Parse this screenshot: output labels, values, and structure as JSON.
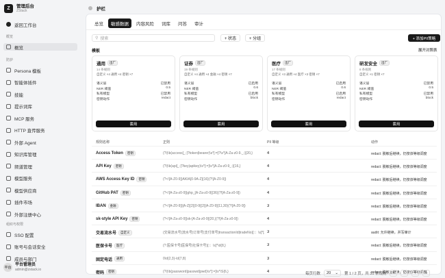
{
  "app": {
    "title": "管理后台",
    "subtitle": "ZStack",
    "logo": "Z"
  },
  "sidebar": {
    "back": "返回工作台",
    "section1": "概览",
    "overview": "概览",
    "section2": "防护",
    "items": [
      "Persona 模板",
      "智能体插件",
      "技能",
      "提示词库",
      "MCP 服务",
      "HTTP 直传服务",
      "外部 Agent",
      "知识库管理",
      "频道管理",
      "模型服务",
      "模型供应商",
      "插件市场",
      "外部注册中心"
    ],
    "section3": "组织与权限",
    "items2": [
      "SSO 配置",
      "账号与会话安全",
      "成员与部门"
    ]
  },
  "user": {
    "avatar": "平台",
    "name": "平台管理员",
    "email": "admin@zstack.io"
  },
  "header": {
    "title": "护栏"
  },
  "tabs": [
    "总览",
    "敏感数据",
    "内容风险",
    "词库",
    "问答",
    "审计"
  ],
  "active_tab": 1,
  "search": {
    "placeholder": "搜索"
  },
  "filters": {
    "status": "+ 状态",
    "group": "+ 分组"
  },
  "add_button": "+ 添加PII策略",
  "templates_title": "模板",
  "expand_label": "展开对照表",
  "templates": [
    {
      "name": "通用",
      "tag": "出厂",
      "count": "14 条规则",
      "summary": "自定义 ×4  通用 ×4  密钥 ×7",
      "rows": [
        [
          "语义层",
          "已禁用"
        ],
        [
          "NER 阈值",
          "0.5"
        ],
        [
          "私有模型",
          "已禁用"
        ],
        [
          "密钥动作",
          "redact"
        ]
      ],
      "apply": "套用"
    },
    {
      "name": "证券",
      "tag": "出厂",
      "count": "19 条规则",
      "summary": "自定义 ×4  通用 ×4  金融 ×4  密钥 ×7",
      "rows": [
        [
          "语义层",
          "已启用"
        ],
        [
          "NER 阈值",
          "0.6"
        ],
        [
          "私有模型",
          "已启用"
        ],
        [
          "密钥动作",
          "block"
        ]
      ],
      "apply": "套用"
    },
    {
      "name": "医疗",
      "tag": "出厂",
      "count": "17 条规则",
      "summary": "自定义 ×3  通用 ×4  医疗 ×3  密钥 ×7",
      "rows": [
        [
          "语义层",
          "已启用"
        ],
        [
          "NER 阈值",
          "0.6"
        ],
        [
          "私有模型",
          "已启用"
        ],
        [
          "密钥动作",
          "redact"
        ]
      ],
      "apply": "套用"
    },
    {
      "name": "研发安全",
      "tag": "出厂",
      "count": "8 条规则",
      "summary": "自定义 ×1  密钥 ×7",
      "rows": [
        [
          "语义层",
          "已禁用"
        ],
        [
          "NER 阈值",
          "0.5"
        ],
        [
          "私有模型",
          "已禁用"
        ],
        [
          "密钥动作",
          "block"
        ]
      ],
      "apply": "套用"
    }
  ],
  "table": {
    "headers": [
      "规则名称",
      "正则",
      "PII 等级",
      "动作"
    ],
    "rows": [
      {
        "name": "Access Token",
        "tag": "密钥",
        "regex": "(?i)\\b(access[_-]?token|bearer)\\s*[:=]?\\s*[A-Za-z0-9._-]{20,}",
        "pii": "4",
        "action": "redact: 脱敏后继续，仍按该等级调度"
      },
      {
        "name": "API Key",
        "tag": "密钥",
        "regex": "(?i)\\b(api[_-]?key|apikey)\\s*[:=]\\s*[A-Za-z0-9_-]{16,}",
        "pii": "4",
        "action": "redact: 脱敏后继续，仍按该等级调度"
      },
      {
        "name": "AWS Access Key ID",
        "tag": "密钥",
        "regex": "(?<![A-Z0-9])AKIA[0-9A-Z]{16}(?![A-Z0-9])",
        "pii": "4",
        "action": "redact: 脱敏后继续，仍按该等级调度"
      },
      {
        "name": "GitHub PAT",
        "tag": "密钥",
        "regex": "(?<![A-Za-z0-9])ghp_[A-Za-z0-9]{36}(?![A-Za-z0-9])",
        "pii": "4",
        "action": "redact: 脱敏后继续，仍按该等级调度"
      },
      {
        "name": "IBAN",
        "tag": "金融",
        "regex": "(?<![A-Z0-9])[A-Z]{2}[0-9]{2}[A-Z0-9]{11,30}(?![A-Z0-9])",
        "pii": "3",
        "action": "redact: 脱敏后继续，仍按该等级调度"
      },
      {
        "name": "sk-style API Key",
        "tag": "密钥",
        "regex": "(?<![A-Za-z0-9])sk-[A-Za-z0-9]{20,}(?![A-Za-z0-9])",
        "pii": "4",
        "action": "redact: 脱敏后继续，仍按该等级调度"
      },
      {
        "name": "交易流水号",
        "tag": "自定义",
        "regex": "(交易流水号|流水号|订单号|支付单号|transactionId|tradeNo)[:：\\s]*[A-Za-z0-9]{10,}",
        "pii": "3",
        "action": "audit: 允许继续，并写审计"
      },
      {
        "name": "医保卡号",
        "tag": "医疗",
        "regex": "(?:医保卡号|医保号|社保卡号)[:：\\s]*\\d{8,}",
        "pii": "3",
        "action": "redact: 脱敏后继续，仍按该等级调度"
      },
      {
        "name": "固定电话",
        "tag": "通用",
        "regex": "0\\d{2,3}-\\d{7,8}",
        "pii": "3",
        "action": "redact: 脱敏后继续，仍按该等级调度"
      },
      {
        "name": "密码",
        "tag": "密钥",
        "regex": "(?i)\\b(password|passwd|pwd)\\s*[:=]\\s*\\S{6,}",
        "pii": "4",
        "action": "redact: 脱敏后继续，仍按该等级调度"
      }
    ]
  },
  "footer": {
    "rows_label": "每页行数",
    "rows_value": "20",
    "page_info": "第 1 / 2 页，共 31 条规则",
    "first": "«",
    "prev": "‹",
    "next": "›",
    "last": "»"
  }
}
